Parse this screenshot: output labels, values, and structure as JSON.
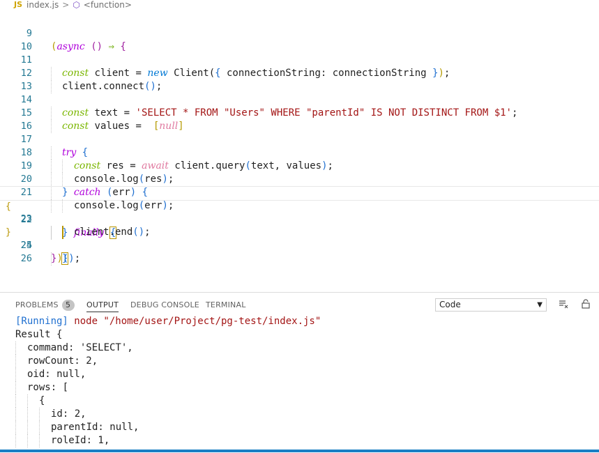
{
  "breadcrumb": {
    "file_badge": "JS",
    "file": "index.js",
    "separator": ">",
    "symbol_icon": "cube-icon",
    "symbol": "<function>"
  },
  "editor": {
    "lines": [
      {
        "n": "9"
      },
      {
        "n": "10"
      },
      {
        "n": "11"
      },
      {
        "n": "12"
      },
      {
        "n": "13"
      },
      {
        "n": "14"
      },
      {
        "n": "15"
      },
      {
        "n": "16"
      },
      {
        "n": "17"
      },
      {
        "n": "18"
      },
      {
        "n": "19"
      },
      {
        "n": "20"
      },
      {
        "n": "21"
      },
      {
        "n": "22"
      },
      {
        "n": "23"
      },
      {
        "n": "24"
      },
      {
        "n": "25"
      },
      {
        "n": "26"
      }
    ],
    "gutter_marks": {
      "open": "{",
      "close": "}"
    },
    "t": {
      "async": "async",
      "open_paren": "(",
      "empty_parens": "()",
      "arrow": "⇒",
      "open_brace": "{",
      "const": "const",
      "new": "new",
      "await": "await",
      "try": "try",
      "catch": "catch",
      "finally": "finally",
      "client_decl": " client = ",
      "Client_call": " Client(",
      "obj_open": "{",
      "conn_prop": " connectionString: connectionString ",
      "obj_close": "}",
      "close_paren": ")",
      "semi": ";",
      "client_connect": "client.connect",
      "call_parens": "()",
      "text_decl": " text = ",
      "query_str": "'SELECT * FROM \"Users\" WHERE \"parentId\" IS NOT DISTINCT FROM $1'",
      "values_decl": " values = ",
      "arr_open": "[",
      "null": "null",
      "arr_close": "]",
      "res_decl": " res = ",
      "query_call": " client.query",
      "query_args": "text, values",
      "console_log": "console.log",
      "res_arg": "res",
      "err_arg": "err",
      "close_brace": "}",
      "client_end": "client.end",
      "iife_close": "})();",
      "space": " "
    }
  },
  "panel": {
    "tabs": [
      {
        "label": "PROBLEMS",
        "badge": "5"
      },
      {
        "label": "OUTPUT"
      },
      {
        "label": "DEBUG CONSOLE"
      },
      {
        "label": "TERMINAL"
      }
    ],
    "active_tab": "OUTPUT",
    "select_value": "Code",
    "output": {
      "running_tag": "[Running]",
      "running_cmd": " node \"/home/user/Project/pg-test/index.js\"",
      "lines": [
        "Result {",
        "command: 'SELECT',",
        "rowCount: 2,",
        "oid: null,",
        "rows: [",
        "{",
        "id: 2,",
        "parentId: null,",
        "roleId: 1,"
      ]
    }
  },
  "colors": {
    "accent": "#1a7fc4",
    "keyword": "#af00db",
    "string": "#a31515",
    "line_number": "#237893"
  }
}
